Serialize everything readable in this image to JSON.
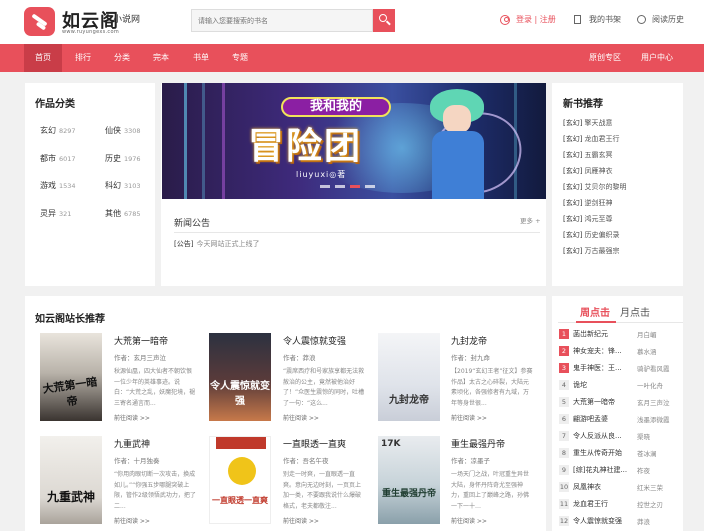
{
  "header": {
    "site_name": "如云阁",
    "site_sub": "小说网",
    "site_url": "www.ruyungexs.com",
    "search_placeholder": "请输入您要搜索的书名",
    "login_label": "登录 | 注册",
    "bookshelf_label": "我的书架",
    "history_label": "阅读历史"
  },
  "nav": {
    "items": [
      "首页",
      "排行",
      "分类",
      "完本",
      "书单",
      "专题"
    ],
    "active": "首页",
    "right_items": [
      "原创专区",
      "用户中心"
    ]
  },
  "categories": {
    "title": "作品分类",
    "items": [
      {
        "name": "玄幻",
        "count": "8297"
      },
      {
        "name": "仙侠",
        "count": "3308"
      },
      {
        "name": "都市",
        "count": "6017"
      },
      {
        "name": "历史",
        "count": "1976"
      },
      {
        "name": "游戏",
        "count": "1534"
      },
      {
        "name": "科幻",
        "count": "3103"
      },
      {
        "name": "灵异",
        "count": "321"
      },
      {
        "name": "其他",
        "count": "6785"
      }
    ]
  },
  "banner": {
    "subtitle": "我和我的",
    "title": "冒险团",
    "author": "liuyuxi◎著"
  },
  "notice": {
    "title": "新闻公告",
    "more": "更多 +",
    "items": [
      {
        "tag": "[公告]",
        "text": "今天网站正式上线了"
      }
    ]
  },
  "new_books": {
    "title": "新书推荐",
    "items": [
      {
        "tag": "[玄幻]",
        "name": "擎天战意"
      },
      {
        "tag": "[玄幻]",
        "name": "龙血君王行"
      },
      {
        "tag": "[玄幻]",
        "name": "五霸玄冥"
      },
      {
        "tag": "[玄幻]",
        "name": "凤雁神衣"
      },
      {
        "tag": "[玄幻]",
        "name": "艾贝尔的黎明"
      },
      {
        "tag": "[玄幻]",
        "name": "逆剑狂神"
      },
      {
        "tag": "[玄幻]",
        "name": "鸿元至尊"
      },
      {
        "tag": "[玄幻]",
        "name": "历史偏织录"
      },
      {
        "tag": "[玄幻]",
        "name": "万古最强宗"
      }
    ]
  },
  "recommend": {
    "title": "如云阁站长推荐",
    "read_label": "前往阅读 >>",
    "books": [
      {
        "title": "大荒第一暗帝",
        "author": "作者：玄月三声泣",
        "desc": "秋源仙凰，四大仙者不朝饮恨一位少年的英雄事迹。说白：“大荒之乱，妖魔犯境，褪三寄名通言而...",
        "cover_text": "大荒第一暗帝"
      },
      {
        "title": "令人震惊就变强",
        "author": "作者：莽浪",
        "desc": "“震席西疗和号家族享都无法救赦治的公主，竟然被他治好了！”众医生震惊的同时，吐槽了一句：“这么...",
        "cover_text": "令人震惊就变强"
      },
      {
        "title": "九封龙帝",
        "author": "作者：封九命",
        "desc": "【2019“玄幻王者”征文】参赛作品】太古之心碎裂，大陆元素顷化，各强修者有九域，万年等身世很...",
        "cover_text": "九封龙帝"
      },
      {
        "title": "九重武神",
        "author": "作者：十月独奏",
        "desc": "“你用肉眼切断一次攻击，换成如儿。”“你强五步哪腿突破上限，管作2级领悟武功力，把了二...",
        "cover_text": "九重武神"
      },
      {
        "title": "一直眼透一直爽",
        "author": "作者：吾名午夜",
        "desc": "别走一时爽，一直眼透一直爽。意向无边时刻，一页页上加一类，不要跟我说什么爆破格式，老夫都敬注...",
        "cover_text": "一直眼透一直爽"
      },
      {
        "title": "重生最强丹帝",
        "author": "作者：凉墨子",
        "desc": "一场天门之战，叶冠重生异世大陆，身怀丹阵奇尤至强神力，重回上了巅峰之路，孙佛一下一十…",
        "cover_text": "重生最强丹帝"
      }
    ]
  },
  "ranking": {
    "tabs": [
      "周点击",
      "月点击"
    ],
    "active_tab": "周点击",
    "items": [
      {
        "rank": "1",
        "name": "菡岀新纪元",
        "author": "月白嵋"
      },
      {
        "rank": "2",
        "name": "神女宠夫：锋...",
        "author": "慕水涵"
      },
      {
        "rank": "3",
        "name": "鬼手神医：王...",
        "author": "骑驴看风霞"
      },
      {
        "rank": "4",
        "name": "诡坨",
        "author": "一叶化舟"
      },
      {
        "rank": "5",
        "name": "大荒第一暗帝",
        "author": "玄月三声泣"
      },
      {
        "rank": "6",
        "name": "翩游吧孟婆",
        "author": "浅墨添微霞"
      },
      {
        "rank": "7",
        "name": "令人反派从良...",
        "author": "渠晓"
      },
      {
        "rank": "8",
        "name": "重生从传奇开始",
        "author": "苍冰澜"
      },
      {
        "rank": "9",
        "name": "[综]花丸神社建...",
        "author": "祚夜"
      },
      {
        "rank": "10",
        "name": "凤凰神衣",
        "author": "红米三荣"
      },
      {
        "rank": "11",
        "name": "龙血君王行",
        "author": "控世之刃"
      },
      {
        "rank": "12",
        "name": "令人震惊就变强",
        "author": "莽浪"
      }
    ]
  },
  "colors": {
    "brand": "#e8505b",
    "nav_active": "#c93d48"
  }
}
